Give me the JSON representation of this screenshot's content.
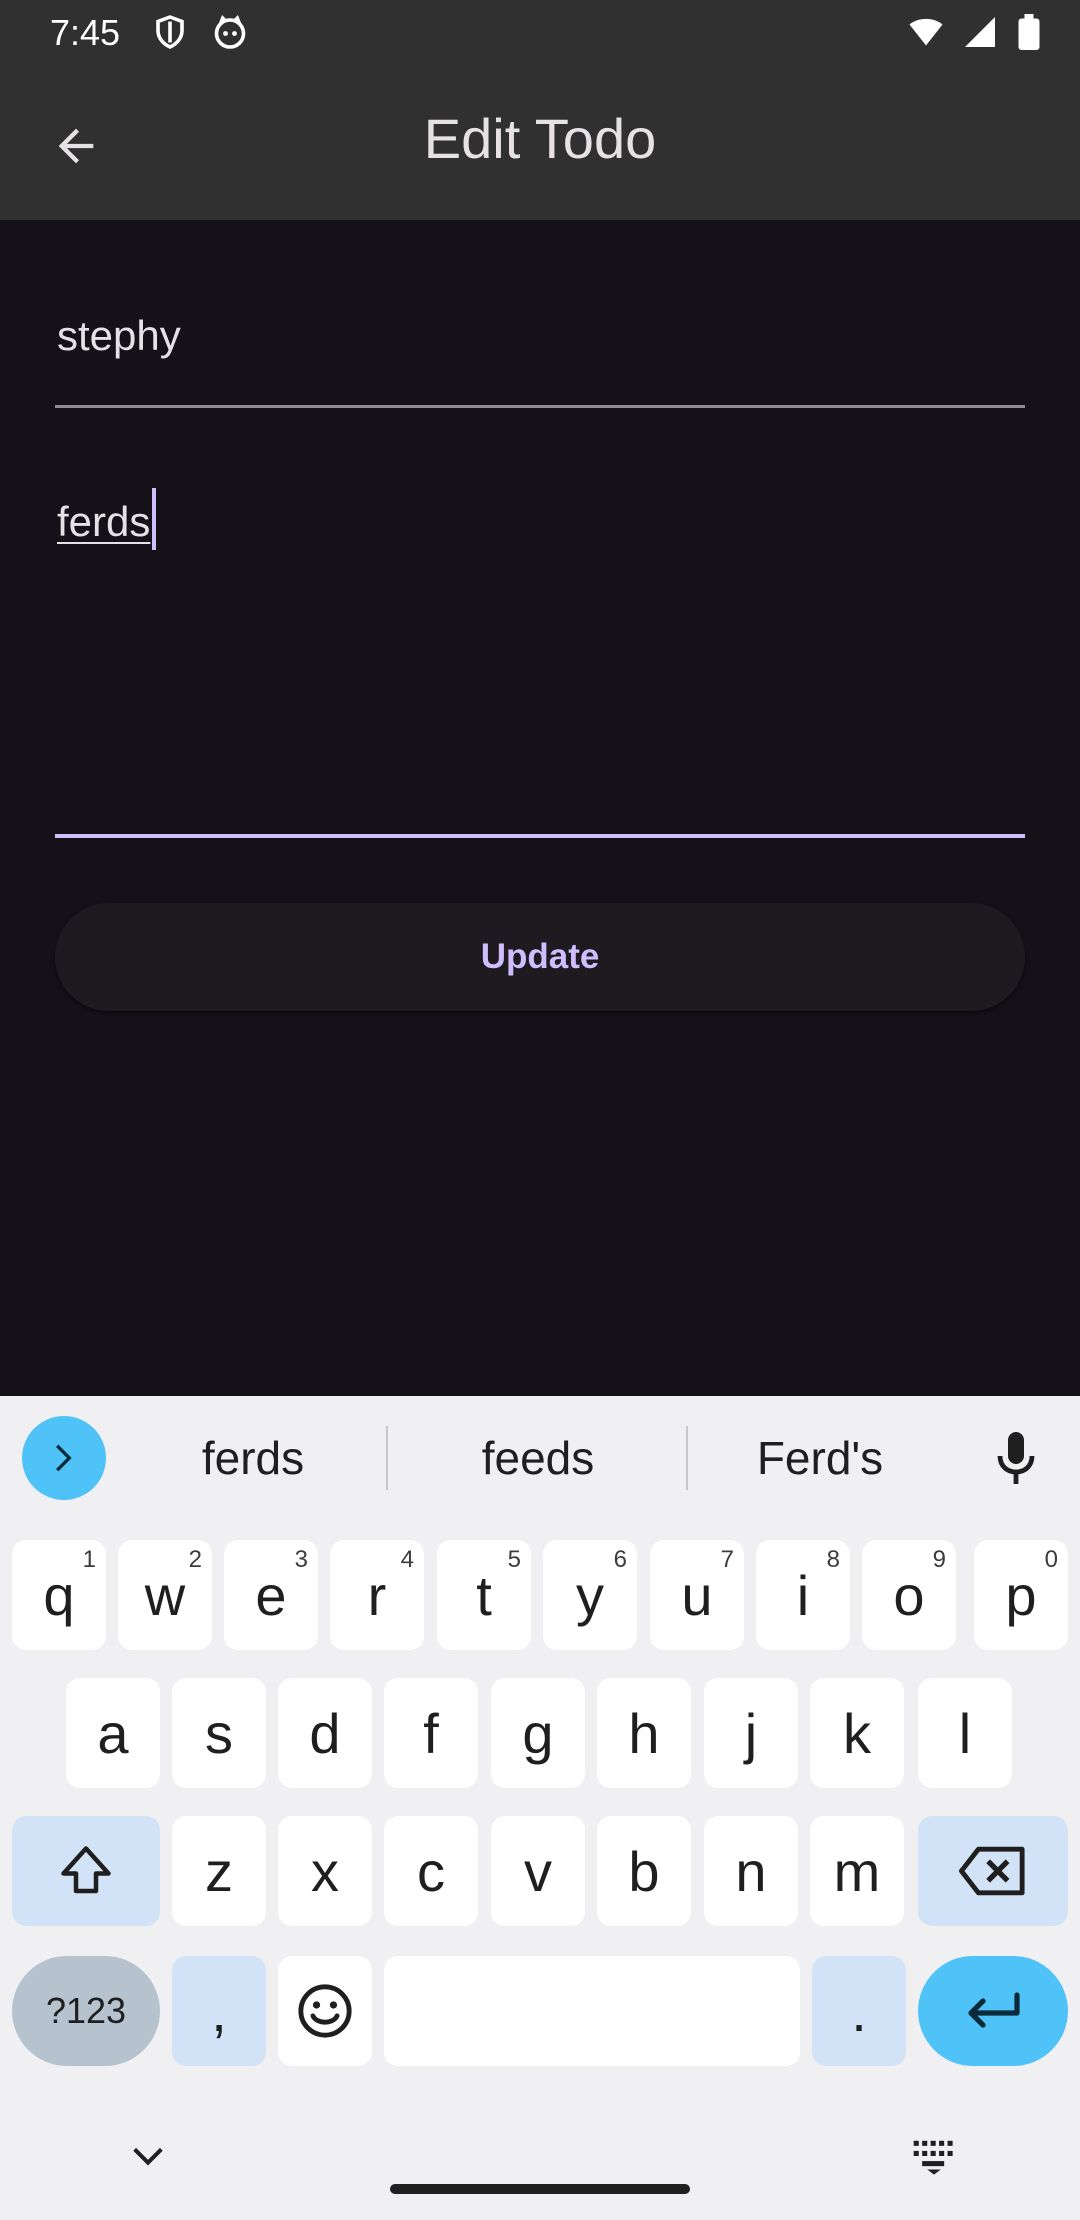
{
  "status_bar": {
    "time": "7:45"
  },
  "app_bar": {
    "title": "Edit Todo"
  },
  "form": {
    "title_value": "stephy",
    "description_value": "ferds",
    "update_label": "Update"
  },
  "keyboard": {
    "suggestions": [
      "ferds",
      "feeds",
      "Ferd's"
    ],
    "row1": [
      {
        "k": "q",
        "h": "1"
      },
      {
        "k": "w",
        "h": "2"
      },
      {
        "k": "e",
        "h": "3"
      },
      {
        "k": "r",
        "h": "4"
      },
      {
        "k": "t",
        "h": "5"
      },
      {
        "k": "y",
        "h": "6"
      },
      {
        "k": "u",
        "h": "7"
      },
      {
        "k": "i",
        "h": "8"
      },
      {
        "k": "o",
        "h": "9"
      },
      {
        "k": "p",
        "h": "0"
      }
    ],
    "row2": [
      "a",
      "s",
      "d",
      "f",
      "g",
      "h",
      "j",
      "k",
      "l"
    ],
    "row3": [
      "z",
      "x",
      "c",
      "v",
      "b",
      "n",
      "m"
    ],
    "symbols_label": "?123",
    "comma_label": ",",
    "period_label": "."
  }
}
